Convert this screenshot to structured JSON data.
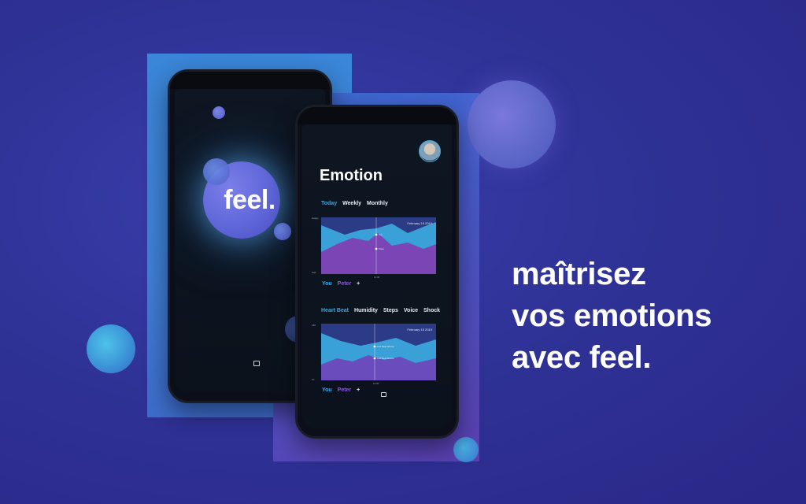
{
  "splash": {
    "brand": "feel."
  },
  "screen": {
    "title": "Emotion",
    "period_tabs": [
      "Today",
      "Weekly",
      "Monthly"
    ],
    "chart1": {
      "date": "February 15 2019",
      "y_top_label": "Happy",
      "y_bottom_label": "Sad",
      "x_marker_label": "11:30",
      "point_labels": [
        "You",
        "Peter"
      ]
    },
    "legend1": {
      "you": "You",
      "peter": "Peter",
      "add": "+"
    },
    "metric_tabs": [
      "Heart Beat",
      "Humidity",
      "Steps",
      "Voice",
      "Shock"
    ],
    "chart2": {
      "date": "February 15 2019",
      "y_top_label": "180",
      "y_bottom_label": "70",
      "x_marker_label": "11:30",
      "point_labels": [
        "140 Beat Minute",
        "110 Beat Minute"
      ]
    },
    "legend2": {
      "you": "You",
      "peter": "Peter",
      "add": "+"
    }
  },
  "tagline": [
    "maîtrisez",
    "vos emotions",
    "avec feel."
  ],
  "colors": {
    "accent": "#3aa7e6",
    "peter": "#8b5bd1",
    "background": "#2f3296"
  }
}
